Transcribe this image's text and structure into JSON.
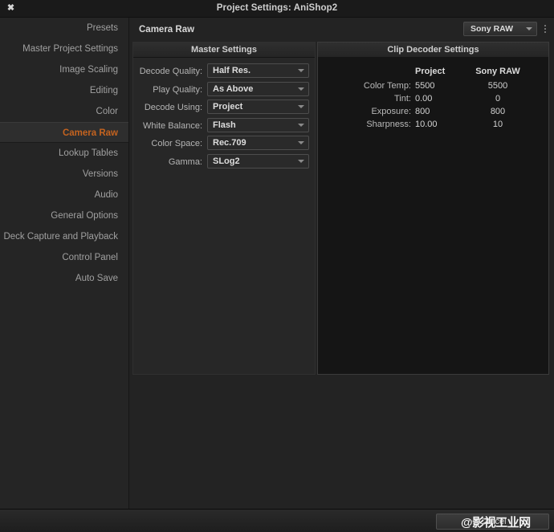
{
  "window": {
    "title": "Project Settings:  AniShop2",
    "close_icon": "close-icon"
  },
  "sidebar": {
    "items": [
      {
        "label": "Presets",
        "active": false
      },
      {
        "label": "Master Project Settings",
        "active": false
      },
      {
        "label": "Image Scaling",
        "active": false
      },
      {
        "label": "Editing",
        "active": false
      },
      {
        "label": "Color",
        "active": false
      },
      {
        "label": "Camera Raw",
        "active": true
      },
      {
        "label": "Lookup Tables",
        "active": false
      },
      {
        "label": "Versions",
        "active": false
      },
      {
        "label": "Audio",
        "active": false
      },
      {
        "label": "General Options",
        "active": false
      },
      {
        "label": "Deck Capture and Playback",
        "active": false
      },
      {
        "label": "Control Panel",
        "active": false
      },
      {
        "label": "Auto Save",
        "active": false
      }
    ]
  },
  "content": {
    "title": "Camera Raw",
    "preset_select": {
      "value": "Sony RAW",
      "chevron_icon": "chevron-down-icon"
    },
    "options_menu_icon": "kebab-menu-icon"
  },
  "master_settings": {
    "header": "Master Settings",
    "rows": [
      {
        "label": "Decode Quality:",
        "value": "Half Res."
      },
      {
        "label": "Play Quality:",
        "value": "As Above"
      },
      {
        "label": "Decode Using:",
        "value": "Project"
      },
      {
        "label": "White Balance:",
        "value": "Flash"
      },
      {
        "label": "Color Space:",
        "value": "Rec.709"
      },
      {
        "label": "Gamma:",
        "value": "SLog2"
      }
    ]
  },
  "clip_decoder_settings": {
    "header": "Clip Decoder Settings",
    "columns": [
      "",
      "Project",
      "Sony RAW"
    ],
    "rows": [
      {
        "label": "Color Temp:",
        "project": "5500",
        "raw": "5500"
      },
      {
        "label": "Tint:",
        "project": "0.00",
        "raw": "0"
      },
      {
        "label": "Exposure:",
        "project": "800",
        "raw": "800"
      },
      {
        "label": "Sharpness:",
        "project": "10.00",
        "raw": "10"
      }
    ]
  },
  "footer": {
    "cancel_label": "Cancel",
    "watermark": "@影视工业网"
  },
  "colors": {
    "accent": "#c4631f",
    "window_bg": "#232323",
    "sidebar_bg": "#252525",
    "panel_master_bg": "#272727",
    "panel_clip_bg": "#151515",
    "titlebar_bg": "#1a1a1a"
  }
}
